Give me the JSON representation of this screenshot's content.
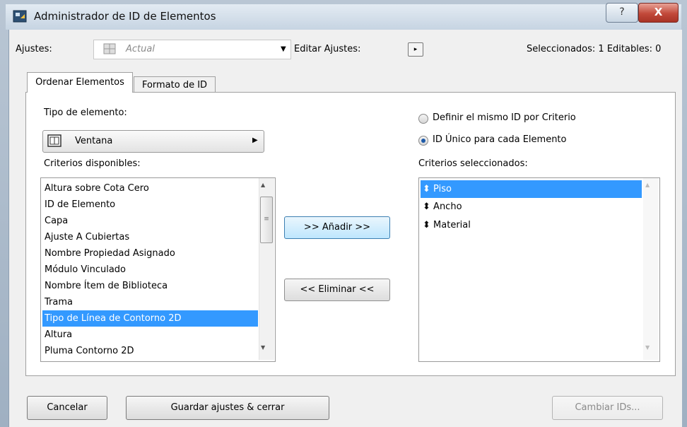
{
  "window": {
    "title": "Administrador de ID de Elementos",
    "help_glyph": "?",
    "close_glyph": "X"
  },
  "toolbar": {
    "ajustes_label": "Ajustes:",
    "ajustes_value": "Actual",
    "editar_label": "Editar Ajustes:",
    "editar_button_glyph": "▸",
    "selection_info": "Seleccionados: 1   Editables: 0"
  },
  "tabs": [
    {
      "label": "Ordenar Elementos",
      "active": true
    },
    {
      "label": "Formato de ID",
      "active": false
    }
  ],
  "left": {
    "tipo_label": "Tipo de elemento:",
    "tipo_value": "Ventana",
    "tipo_arrow": "▶",
    "criterios_label": "Criterios disponibles:",
    "items": [
      "Altura sobre Cota Cero",
      "ID de Elemento",
      "Capa",
      "Ajuste A Cubiertas",
      "Nombre Propiedad Asignado",
      "Módulo Vinculado",
      "Nombre Ítem de Biblioteca",
      "Trama",
      "Tipo de Línea de Contorno 2D",
      "Altura",
      "Pluma Contorno 2D"
    ],
    "selected_index": 8
  },
  "middle": {
    "add_label": ">> Añadir >>",
    "remove_label": "<< Eliminar <<"
  },
  "right": {
    "radio1_label": "Definir el mismo ID por Criterio",
    "radio2_label": "ID Único para cada Elemento",
    "selected_radio": 2,
    "criterios_label": "Criterios seleccionados:",
    "items": [
      "Piso",
      "Ancho",
      "Material"
    ],
    "selected_index": 0,
    "sort_glyph": "⬍"
  },
  "footer": {
    "cancel_label": "Cancelar",
    "save_label": "Guardar ajustes & cerrar",
    "change_label": "Cambiar IDs..."
  },
  "colors": {
    "selection": "#3399ff",
    "title_bar": "#c6d4e2",
    "close_button": "#c2493a"
  }
}
